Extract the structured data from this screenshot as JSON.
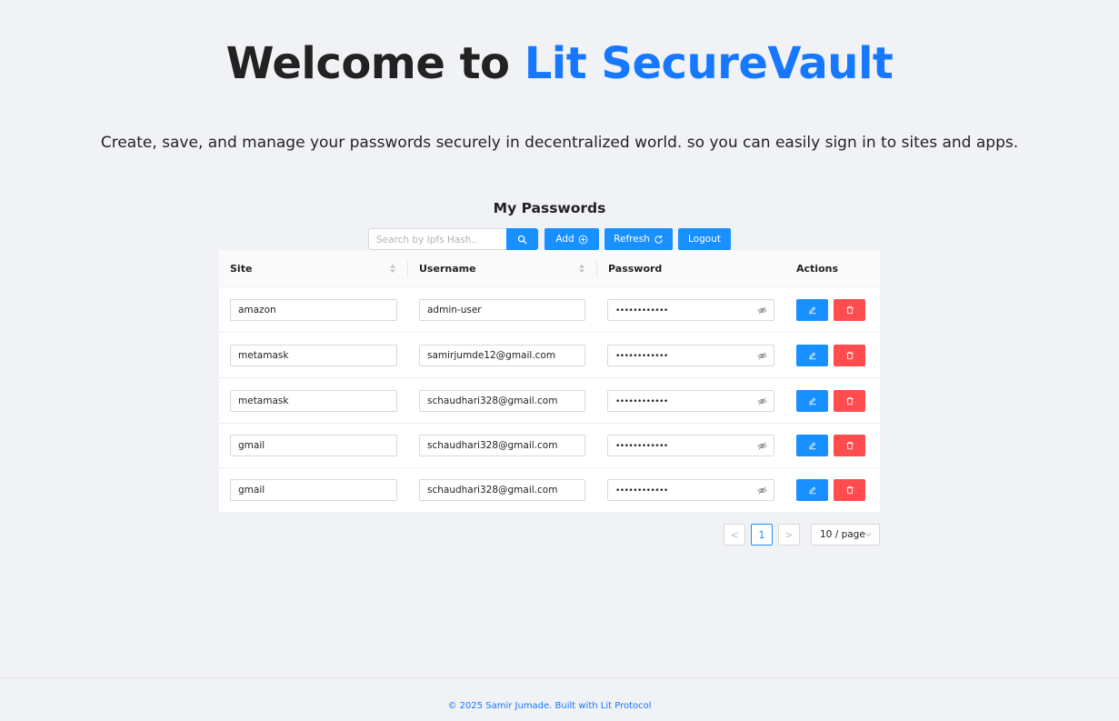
{
  "hero": {
    "title_prefix": "Welcome to ",
    "title_brand": "Lit SecureVault",
    "subtitle": "Create, save, and manage your passwords securely in decentralized world. so you can easily sign in to sites and apps."
  },
  "passwords": {
    "title": "My Passwords",
    "search_placeholder": "Search by Ipfs Hash..",
    "add_label": "Add",
    "refresh_label": "Refresh",
    "logout_label": "Logout",
    "columns": {
      "site": "Site",
      "username": "Username",
      "password": "Password",
      "actions": "Actions"
    },
    "rows": [
      {
        "site": "amazon",
        "username": "admin-user",
        "password": "••••••••••••"
      },
      {
        "site": "metamask",
        "username": "samirjumde12@gmail.com",
        "password": "••••••••••••"
      },
      {
        "site": "metamask",
        "username": "schaudhari328@gmail.com",
        "password": "••••••••••••"
      },
      {
        "site": "gmail",
        "username": "schaudhari328@gmail.com",
        "password": "••••••••••••"
      },
      {
        "site": "gmail",
        "username": "schaudhari328@gmail.com",
        "password": "••••••••••••"
      }
    ]
  },
  "pagination": {
    "prev": "<",
    "current_page": "1",
    "next": ">",
    "page_size": "10 / page"
  },
  "footer": {
    "text": "© 2025 Samir Jumade. Built with Lit Protocol"
  },
  "colors": {
    "primary": "#1890ff",
    "brand": "#1677ff",
    "danger": "#ff4d4f",
    "background": "#f0f2f5"
  },
  "icons": {
    "search_button": "search-icon",
    "add_button": "plus-circle-icon",
    "refresh_button": "refresh-icon",
    "edit_button": "edit-icon",
    "delete_button": "trash-icon",
    "password_toggle": "eye-invisible-icon",
    "sorter": "sort-icon"
  }
}
